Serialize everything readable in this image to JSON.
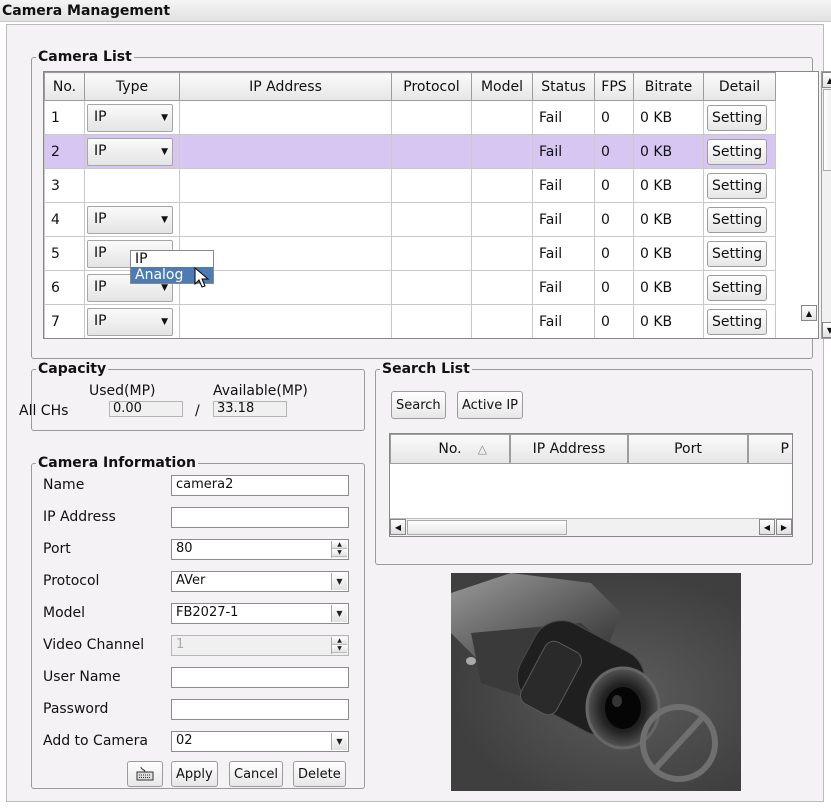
{
  "title": "Camera Management",
  "camera_list": {
    "legend": "Camera List",
    "columns": [
      "No.",
      "Type",
      "IP Address",
      "Protocol",
      "Model",
      "Status",
      "FPS",
      "Bitrate",
      "Detail"
    ],
    "rows": [
      {
        "no": "1",
        "type": "IP",
        "ip": "",
        "protocol": "",
        "model": "",
        "status": "Fail",
        "fps": "0",
        "bitrate": "0 KB",
        "detail": "Setting"
      },
      {
        "no": "2",
        "type": "IP",
        "ip": "",
        "protocol": "",
        "model": "",
        "status": "Fail",
        "fps": "0",
        "bitrate": "0 KB",
        "detail": "Setting"
      },
      {
        "no": "3",
        "type": "",
        "ip": "",
        "protocol": "",
        "model": "",
        "status": "Fail",
        "fps": "0",
        "bitrate": "0 KB",
        "detail": "Setting"
      },
      {
        "no": "4",
        "type": "IP",
        "ip": "",
        "protocol": "",
        "model": "",
        "status": "Fail",
        "fps": "0",
        "bitrate": "0 KB",
        "detail": "Setting"
      },
      {
        "no": "5",
        "type": "IP",
        "ip": "",
        "protocol": "",
        "model": "",
        "status": "Fail",
        "fps": "0",
        "bitrate": "0 KB",
        "detail": "Setting"
      },
      {
        "no": "6",
        "type": "IP",
        "ip": "",
        "protocol": "",
        "model": "",
        "status": "Fail",
        "fps": "0",
        "bitrate": "0 KB",
        "detail": "Setting"
      },
      {
        "no": "7",
        "type": "IP",
        "ip": "",
        "protocol": "",
        "model": "",
        "status": "Fail",
        "fps": "0",
        "bitrate": "0 KB",
        "detail": "Setting"
      }
    ],
    "dropdown_options": [
      "IP",
      "Analog"
    ],
    "dropdown_highlighted": "Analog"
  },
  "capacity": {
    "legend": "Capacity",
    "used_label": "Used(MP)",
    "available_label": "Available(MP)",
    "row_label": "All CHs",
    "used_value": "0.00",
    "separator": "/",
    "available_value": "33.18"
  },
  "search_list": {
    "legend": "Search List",
    "search_button": "Search",
    "active_ip_button": "Active IP",
    "columns": [
      "No.",
      "IP Address",
      "Port",
      "P"
    ]
  },
  "camera_info": {
    "legend": "Camera Information",
    "fields": {
      "name": {
        "label": "Name",
        "value": "camera2"
      },
      "ip": {
        "label": "IP Address",
        "value": ""
      },
      "port": {
        "label": "Port",
        "value": "80"
      },
      "protocol": {
        "label": "Protocol",
        "value": "AVer"
      },
      "model": {
        "label": "Model",
        "value": "FB2027-1"
      },
      "video_channel": {
        "label": "Video Channel",
        "value": "1"
      },
      "user_name": {
        "label": "User Name",
        "value": ""
      },
      "password": {
        "label": "Password",
        "value": ""
      },
      "add_to_camera": {
        "label": "Add to Camera",
        "value": "02"
      }
    },
    "apply_button": "Apply",
    "cancel_button": "Cancel",
    "delete_button": "Delete"
  },
  "colors": {
    "selected_row": "#d7c6f2",
    "dropdown_highlight": "#4d7bb3"
  },
  "icons": {
    "keyboard_button": "keyboard-icon",
    "preview_overlay": "no-signal-icon"
  }
}
